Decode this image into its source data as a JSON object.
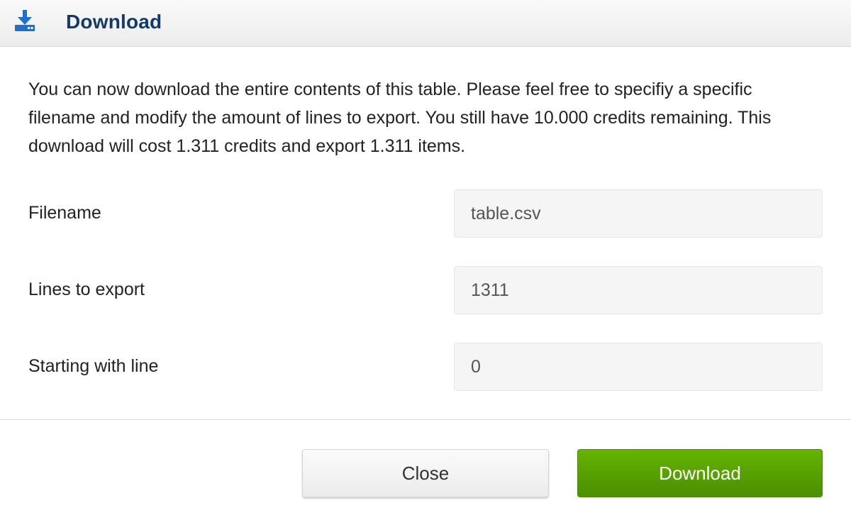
{
  "header": {
    "icon": "download-icon",
    "title": "Download",
    "title_color": "#123a6b",
    "icon_color": "#1e6fd0"
  },
  "intro_text": "You can now download the entire contents of this table. Please feel free to specifiy a specific filename and modify the amount of lines to export. You still have 10.000 credits remaining. This download will cost 1.311 credits and export 1.311 items.",
  "fields": {
    "filename": {
      "label": "Filename",
      "value": "table.csv"
    },
    "lines": {
      "label": "Lines to export",
      "value": "1311"
    },
    "start": {
      "label": "Starting with line",
      "value": "0"
    }
  },
  "buttons": {
    "close_label": "Close",
    "download_label": "Download",
    "download_color": "#5ea302"
  }
}
